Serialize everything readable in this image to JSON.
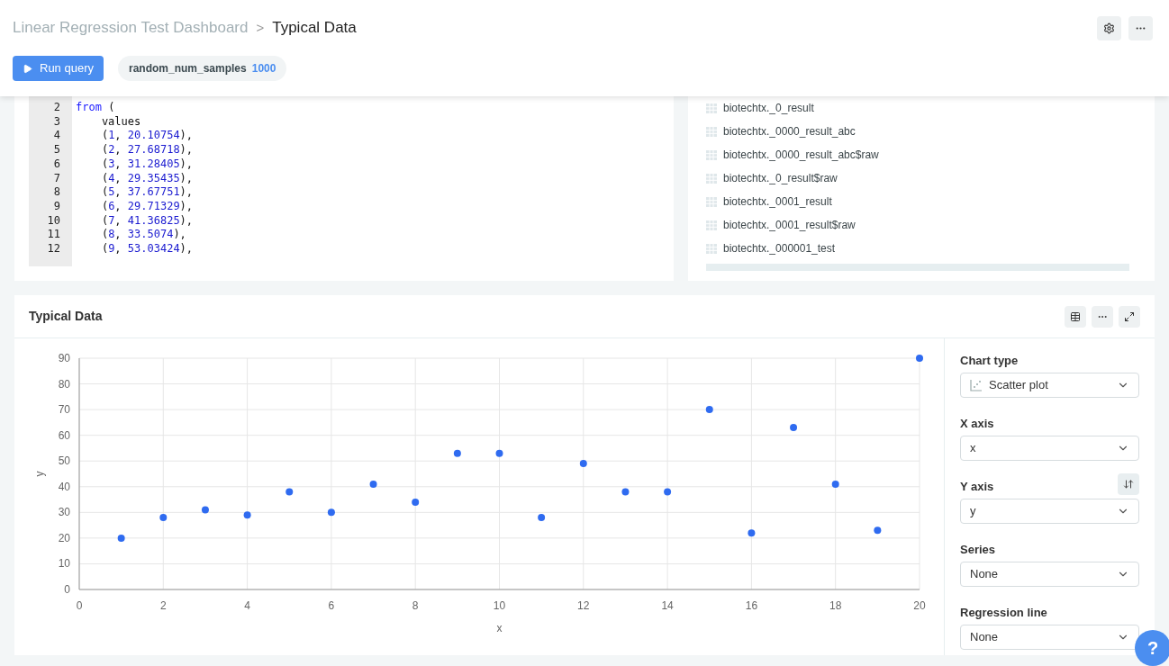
{
  "breadcrumb": {
    "parent": "Linear Regression Test Dashboard",
    "separator": ">",
    "current": "Typical Data"
  },
  "toolbar": {
    "run_button": "Run query",
    "parameter": {
      "name": "random_num_samples",
      "value": "1000"
    }
  },
  "editor": {
    "lines": [
      {
        "number": "2",
        "tokens": [
          {
            "text": "from",
            "kind": "keyword"
          },
          {
            "text": " (",
            "kind": "plain"
          }
        ]
      },
      {
        "number": "3",
        "tokens": [
          {
            "text": "    values",
            "kind": "plain"
          }
        ]
      },
      {
        "number": "4",
        "tokens": [
          {
            "text": "    (",
            "kind": "plain"
          },
          {
            "text": "1",
            "kind": "number"
          },
          {
            "text": ", ",
            "kind": "plain"
          },
          {
            "text": "20.10754",
            "kind": "number"
          },
          {
            "text": "),",
            "kind": "plain"
          }
        ]
      },
      {
        "number": "5",
        "tokens": [
          {
            "text": "    (",
            "kind": "plain"
          },
          {
            "text": "2",
            "kind": "number"
          },
          {
            "text": ", ",
            "kind": "plain"
          },
          {
            "text": "27.68718",
            "kind": "number"
          },
          {
            "text": "),",
            "kind": "plain"
          }
        ]
      },
      {
        "number": "6",
        "tokens": [
          {
            "text": "    (",
            "kind": "plain"
          },
          {
            "text": "3",
            "kind": "number"
          },
          {
            "text": ", ",
            "kind": "plain"
          },
          {
            "text": "31.28405",
            "kind": "number"
          },
          {
            "text": "),",
            "kind": "plain"
          }
        ]
      },
      {
        "number": "7",
        "tokens": [
          {
            "text": "    (",
            "kind": "plain"
          },
          {
            "text": "4",
            "kind": "number"
          },
          {
            "text": ", ",
            "kind": "plain"
          },
          {
            "text": "29.35435",
            "kind": "number"
          },
          {
            "text": "),",
            "kind": "plain"
          }
        ]
      },
      {
        "number": "8",
        "tokens": [
          {
            "text": "    (",
            "kind": "plain"
          },
          {
            "text": "5",
            "kind": "number"
          },
          {
            "text": ", ",
            "kind": "plain"
          },
          {
            "text": "37.67751",
            "kind": "number"
          },
          {
            "text": "),",
            "kind": "plain"
          }
        ]
      },
      {
        "number": "9",
        "tokens": [
          {
            "text": "    (",
            "kind": "plain"
          },
          {
            "text": "6",
            "kind": "number"
          },
          {
            "text": ", ",
            "kind": "plain"
          },
          {
            "text": "29.71329",
            "kind": "number"
          },
          {
            "text": "),",
            "kind": "plain"
          }
        ]
      },
      {
        "number": "10",
        "tokens": [
          {
            "text": "    (",
            "kind": "plain"
          },
          {
            "text": "7",
            "kind": "number"
          },
          {
            "text": ", ",
            "kind": "plain"
          },
          {
            "text": "41.36825",
            "kind": "number"
          },
          {
            "text": "),",
            "kind": "plain"
          }
        ]
      },
      {
        "number": "11",
        "tokens": [
          {
            "text": "    (",
            "kind": "plain"
          },
          {
            "text": "8",
            "kind": "number"
          },
          {
            "text": ", ",
            "kind": "plain"
          },
          {
            "text": "33.5074",
            "kind": "number"
          },
          {
            "text": "),",
            "kind": "plain"
          }
        ]
      },
      {
        "number": "12",
        "tokens": [
          {
            "text": "    (",
            "kind": "plain"
          },
          {
            "text": "9",
            "kind": "number"
          },
          {
            "text": ", ",
            "kind": "plain"
          },
          {
            "text": "53.03424",
            "kind": "number"
          },
          {
            "text": "),",
            "kind": "plain"
          }
        ]
      }
    ]
  },
  "tables": [
    "biotechtx._0_result",
    "biotechtx._0000_result_abc",
    "biotechtx._0000_result_abc$raw",
    "biotechtx._0_result$raw",
    "biotechtx._0001_result",
    "biotechtx._0001_result$raw",
    "biotechtx._000001_test"
  ],
  "chart_card": {
    "title": "Typical Data",
    "chart_data": {
      "type": "scatter",
      "xlabel": "x",
      "ylabel": "y",
      "xlim": [
        0,
        20
      ],
      "ylim": [
        0,
        90
      ],
      "xticks": [
        0,
        2,
        4,
        6,
        8,
        10,
        12,
        14,
        16,
        18,
        20
      ],
      "yticks": [
        0,
        10,
        20,
        30,
        40,
        50,
        60,
        70,
        80,
        90
      ],
      "x": [
        1,
        2,
        3,
        4,
        5,
        6,
        7,
        8,
        9,
        10,
        11,
        12,
        13,
        14,
        15,
        16,
        17,
        18,
        19,
        20
      ],
      "grid": true,
      "series": [
        {
          "color": "#2f6bf0",
          "values": [
            20,
            28,
            31,
            29,
            38,
            30,
            41,
            34,
            53,
            53,
            28,
            49,
            38,
            38,
            70,
            22,
            63,
            41,
            23,
            90
          ]
        }
      ]
    },
    "settings": [
      {
        "label": "Chart type",
        "value": "Scatter plot",
        "kind": "chart"
      },
      {
        "label": "X axis",
        "value": "x",
        "kind": "plain"
      },
      {
        "label": "Y axis",
        "value": "y",
        "kind": "swap"
      },
      {
        "label": "Series",
        "value": "None",
        "kind": "plain"
      },
      {
        "label": "Regression line",
        "value": "None",
        "kind": "plain"
      }
    ]
  },
  "help_button": "?"
}
